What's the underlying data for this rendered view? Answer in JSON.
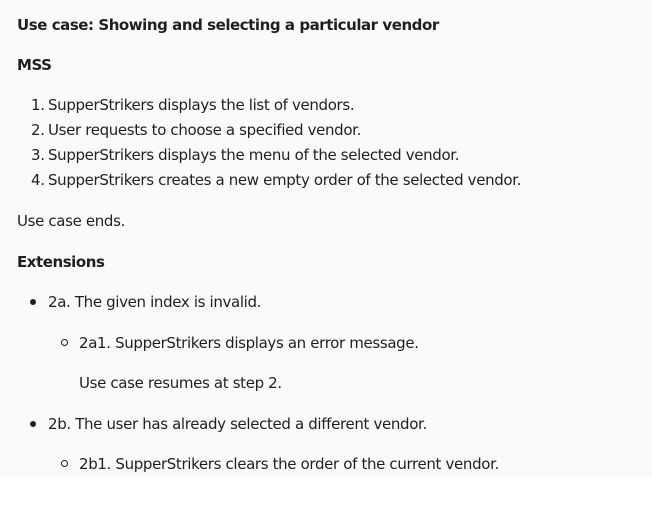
{
  "title": "Use case: Showing and selecting a particular vendor",
  "mss_heading": "MSS",
  "mss_steps": [
    {
      "num": "1.",
      "text": "SupperStrikers displays the list of vendors."
    },
    {
      "num": "2.",
      "text": "User requests to choose a specified vendor."
    },
    {
      "num": "3.",
      "text": "SupperStrikers displays the menu of the selected vendor."
    },
    {
      "num": "4.",
      "text": "SupperStrikers creates a new empty order of the selected vendor."
    }
  ],
  "use_case_ends": "Use case ends.",
  "extensions_heading": "Extensions",
  "extensions": [
    {
      "text": "2a. The given index is invalid.",
      "sub": {
        "text": "2a1. SupperStrikers displays an error message.",
        "note": "Use case resumes at step 2."
      }
    },
    {
      "text": "2b. The user has already selected a different vendor.",
      "sub": {
        "text": "2b1. SupperStrikers clears the order of the current vendor."
      }
    }
  ]
}
